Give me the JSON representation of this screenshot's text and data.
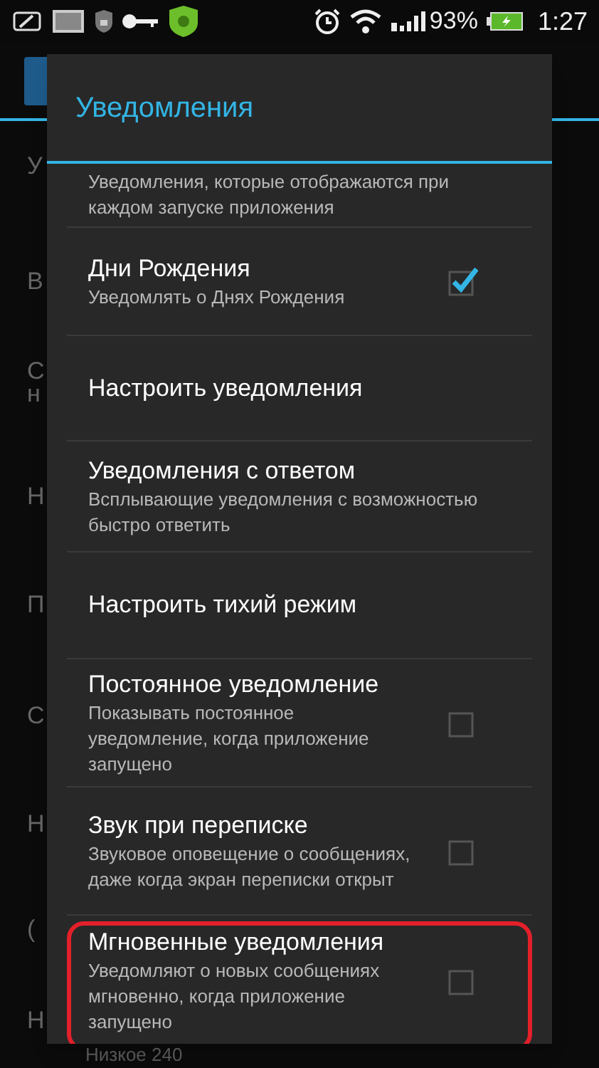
{
  "status_bar": {
    "battery_percent": "93%",
    "time": "1:27"
  },
  "background": {
    "row_letters": [
      "У",
      "В",
      "С",
      "н",
      "Н",
      "П",
      "С",
      "Н",
      "(",
      "Н"
    ],
    "bottom_text": "Низкое 240"
  },
  "dialog": {
    "title": "Уведомления",
    "items": [
      {
        "kind": "plain",
        "summary": "Уведомления, которые отображаются при каждом запуске приложения"
      },
      {
        "kind": "checkbox",
        "title": "Дни Рождения",
        "summary": "Уведомлять о Днях Рождения",
        "checked": true,
        "highlighted": false
      },
      {
        "kind": "plain",
        "title": "Настроить уведомления"
      },
      {
        "kind": "plain",
        "title": "Уведомления с ответом",
        "summary": "Всплывающие уведомления с возможностью быстро ответить"
      },
      {
        "kind": "plain",
        "title": "Настроить тихий режим"
      },
      {
        "kind": "checkbox",
        "title": "Постоянное уведомление",
        "summary": "Показывать постоянное уведомление, когда приложение запущено",
        "checked": false,
        "highlighted": false
      },
      {
        "kind": "checkbox",
        "title": "Звук при переписке",
        "summary": "Звуковое оповещение о сообщениях, даже когда экран переписки открыт",
        "checked": false,
        "highlighted": false
      },
      {
        "kind": "checkbox",
        "title": "Мгновенные уведомления",
        "summary": "Уведомляют о новых сообщениях мгновенно, когда приложение запущено",
        "checked": false,
        "highlighted": true
      }
    ]
  }
}
